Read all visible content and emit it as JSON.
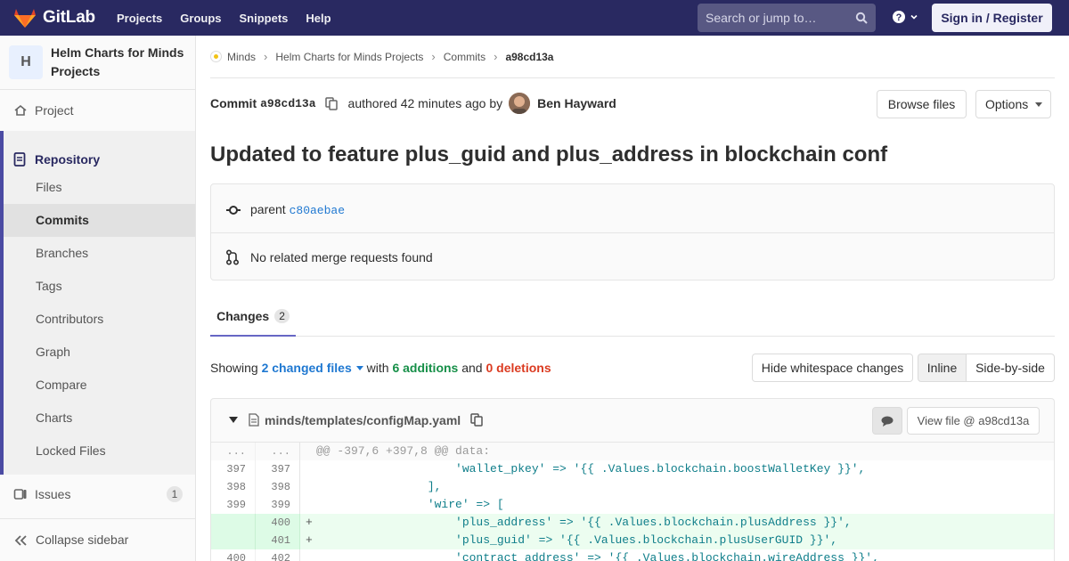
{
  "navbar": {
    "brand": "GitLab",
    "links": [
      "Projects",
      "Groups",
      "Snippets",
      "Help"
    ],
    "search_placeholder": "Search or jump to…",
    "signin_label": "Sign in / Register"
  },
  "sidebar": {
    "project_initial": "H",
    "project_name": "Helm Charts for Minds Projects",
    "project_label": "Project",
    "repository_label": "Repository",
    "repo_items": [
      "Files",
      "Commits",
      "Branches",
      "Tags",
      "Contributors",
      "Graph",
      "Compare",
      "Charts",
      "Locked Files"
    ],
    "active_item": "Commits",
    "issues_label": "Issues",
    "issues_count": "1",
    "collapse_label": "Collapse sidebar"
  },
  "breadcrumb": {
    "items": [
      "Minds",
      "Helm Charts for Minds Projects",
      "Commits"
    ],
    "current": "a98cd13a"
  },
  "commit": {
    "prefix": "Commit",
    "short_sha": "a98cd13a",
    "authored_text": "authored 42 minutes ago by",
    "author": "Ben Hayward",
    "browse_files_label": "Browse files",
    "options_label": "Options",
    "title": "Updated to feature plus_guid and plus_address in blockchain conf",
    "parent_label": "parent",
    "parent_sha": "c80aebae",
    "merge_requests_text": "No related merge requests found"
  },
  "tabs": {
    "changes_label": "Changes",
    "changes_count": "2"
  },
  "summary": {
    "showing": "Showing",
    "changed_files": "2 changed files",
    "with": "with",
    "additions": "6 additions",
    "and": "and",
    "deletions": "0 deletions",
    "hide_whitespace_label": "Hide whitespace changes",
    "inline_label": "Inline",
    "side_by_side_label": "Side-by-side"
  },
  "file": {
    "path": "minds/templates/configMap.yaml",
    "view_file_label": "View file @ a98cd13a"
  },
  "diff_lines": [
    {
      "type": "match",
      "old": "...",
      "new": "...",
      "marker": "",
      "code": "@@ -397,6 +397,8 @@ data:"
    },
    {
      "type": "context",
      "old": "397",
      "new": "397",
      "marker": "",
      "code": "                    'wallet_pkey' => '{{ .Values.blockchain.boostWalletKey }}',"
    },
    {
      "type": "context",
      "old": "398",
      "new": "398",
      "marker": "",
      "code": "                ],"
    },
    {
      "type": "context",
      "old": "399",
      "new": "399",
      "marker": "",
      "code": "                'wire' => ["
    },
    {
      "type": "add",
      "old": "",
      "new": "400",
      "marker": "+",
      "code": "                    'plus_address' => '{{ .Values.blockchain.plusAddress }}',"
    },
    {
      "type": "add",
      "old": "",
      "new": "401",
      "marker": "+",
      "code": "                    'plus_guid' => '{{ .Values.blockchain.plusUserGUID }}',"
    },
    {
      "type": "context",
      "old": "400",
      "new": "402",
      "marker": "",
      "code": "                    'contract_address' => '{{ .Values.blockchain.wireAddress }}',"
    }
  ]
}
